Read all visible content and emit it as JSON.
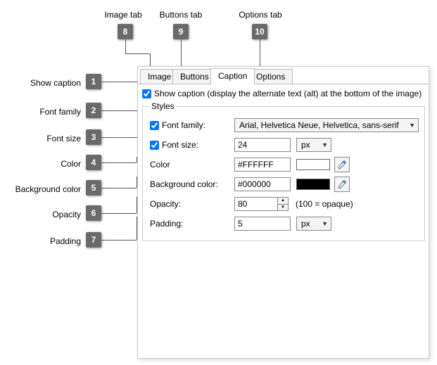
{
  "callouts": {
    "top": {
      "image_tab": "Image tab",
      "buttons_tab": "Buttons tab",
      "options_tab": "Options tab",
      "n8": "8",
      "n9": "9",
      "n10": "10"
    },
    "left": {
      "show_caption": "Show caption",
      "font_family": "Font family",
      "font_size": "Font size",
      "color": "Color",
      "background_color": "Background color",
      "opacity": "Opacity",
      "padding": "Padding",
      "n1": "1",
      "n2": "2",
      "n3": "3",
      "n4": "4",
      "n5": "5",
      "n6": "6",
      "n7": "7"
    }
  },
  "tabs": {
    "image": "Image",
    "buttons": "Buttons",
    "caption": "Caption",
    "options": "Options"
  },
  "caption_panel": {
    "show_caption_label": "Show caption (display the alternate text (alt) at the bottom of the image)",
    "styles_legend": "Styles",
    "font_family_label": "Font family:",
    "font_family_value": "Arial, Helvetica Neue, Helvetica, sans-serif",
    "font_size_label": "Font size:",
    "font_size_value": "24",
    "font_size_unit": "px",
    "color_label": "Color",
    "color_value": "#FFFFFF",
    "color_swatch": "#FFFFFF",
    "bg_label": "Background color:",
    "bg_value": "#000000",
    "bg_swatch": "#000000",
    "opacity_label": "Opacity:",
    "opacity_value": "80",
    "opacity_hint": "(100 = opaque)",
    "padding_label": "Padding:",
    "padding_value": "5",
    "padding_unit": "px"
  }
}
